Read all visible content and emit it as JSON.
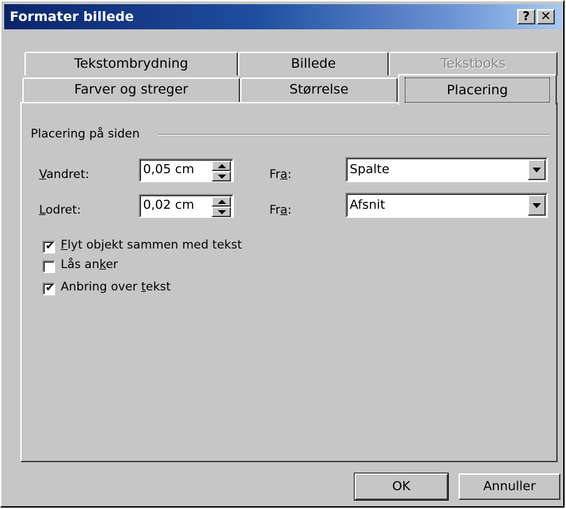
{
  "window": {
    "title": "Formater billede",
    "help_label": "?",
    "close_label": "✕"
  },
  "tabs_back": [
    {
      "label": "Tekstombrydning",
      "enabled": true
    },
    {
      "label": "Billede",
      "enabled": true
    },
    {
      "label": "Tekstboks",
      "enabled": false
    }
  ],
  "tabs_front": [
    {
      "label": "Farver og streger"
    },
    {
      "label": "Størrelse"
    },
    {
      "label": "Placering",
      "active": true
    }
  ],
  "group": {
    "label": "Placering på siden"
  },
  "horizontal": {
    "label_access": "V",
    "label_rest": "andret:",
    "value": "0,05 cm",
    "from_pre": "Fr",
    "from_access": "a",
    "from_post": ":",
    "from_value": "Spalte"
  },
  "vertical": {
    "label_access": "L",
    "label_rest": "odret:",
    "value": "0,02 cm",
    "from_pre": "Fr",
    "from_access": "a",
    "from_post": ":",
    "from_value": "Afsnit"
  },
  "options": [
    {
      "pre": "",
      "access": "F",
      "post": "lyt objekt sammen med tekst",
      "checked": true,
      "mark": "✔"
    },
    {
      "pre": "Lås an",
      "access": "k",
      "post": "er",
      "checked": false,
      "mark": ""
    },
    {
      "pre": "Anbring over ",
      "access": "t",
      "post": "ekst",
      "checked": true,
      "mark": "✔"
    }
  ],
  "buttons": {
    "ok": "OK",
    "cancel": "Annuller"
  }
}
